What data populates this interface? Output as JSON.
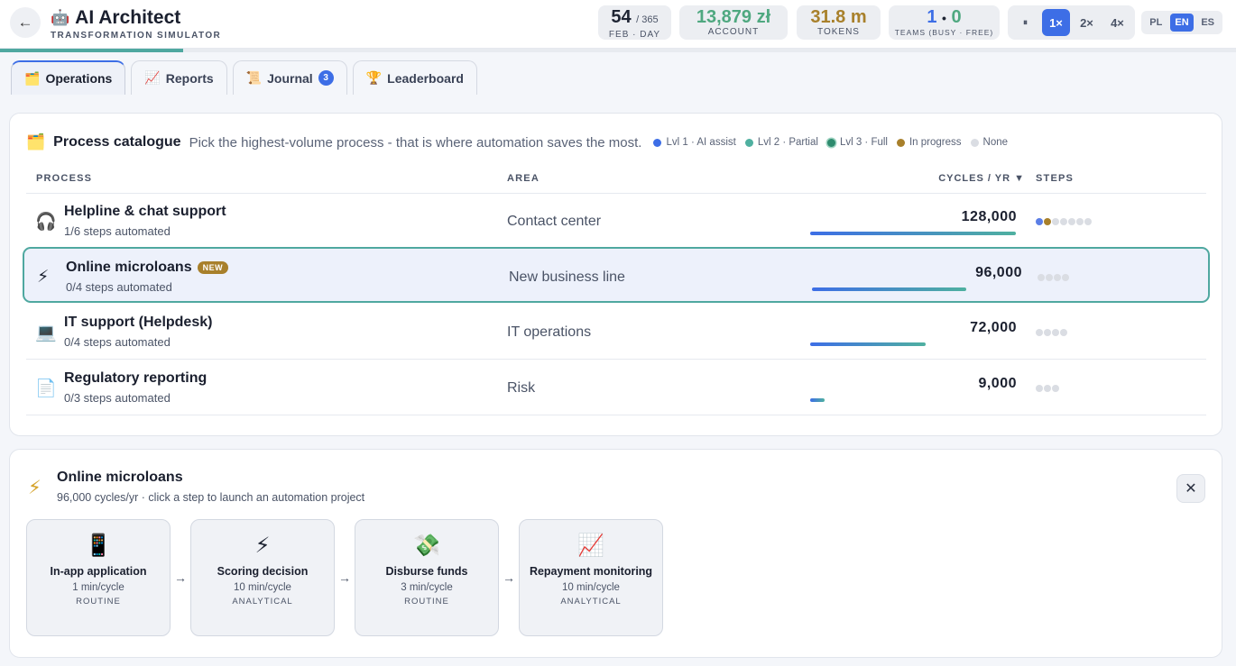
{
  "header": {
    "back_icon": "←",
    "robot_icon": "🤖",
    "title": "AI Architect",
    "subtitle": "TRANSFORMATION SIMULATOR",
    "day": "54",
    "day_total": "/ 365",
    "day_label": "FEB · DAY",
    "account": "13,879 zł",
    "account_label": "ACCOUNT",
    "tokens": "31.8 m",
    "tokens_label": "TOKENS",
    "teams_busy": "1",
    "teams_sep": "•",
    "teams_free": "0",
    "teams_label": "TEAMS (BUSY · FREE)",
    "pause_icon": "⏸",
    "speeds": [
      "1×",
      "2×",
      "4×"
    ],
    "active_speed": "1×",
    "languages": [
      "PL",
      "EN",
      "ES"
    ],
    "active_language": "EN",
    "colors": {
      "account": "#4fa880",
      "tokens": "#a8802b",
      "busy": "#3d6ee6",
      "free": "#4fa880",
      "accent": "#3d6ee6"
    }
  },
  "tabs": [
    {
      "icon": "🗂️",
      "label": "Operations",
      "active": true
    },
    {
      "icon": "📈",
      "label": "Reports"
    },
    {
      "icon": "📜",
      "label": "Journal",
      "badge": "3"
    },
    {
      "icon": "🏆",
      "label": "Leaderboard"
    }
  ],
  "catalogue": {
    "icon": "🗂️",
    "title": "Process catalogue",
    "subtitle": "Pick the highest-volume process - that is where automation saves the most.",
    "legend": [
      {
        "label": "Lvl 1 · AI assist",
        "color": "#3d6ee6"
      },
      {
        "label": "Lvl 2 · Partial",
        "color": "#4fb0a0"
      },
      {
        "label": "Lvl 3 · Full",
        "color": "#2e8b6e"
      },
      {
        "label": "In progress",
        "color": "#a8802b"
      },
      {
        "label": "None",
        "color": "#dadde3"
      }
    ],
    "columns": {
      "process": "PROCESS",
      "area": "AREA",
      "cycles": "CYCLES / YR ▼",
      "steps": "STEPS"
    },
    "rows": [
      {
        "icon": "🎧",
        "name": "Helpline & chat support",
        "sub": "1/6 steps automated",
        "area": "Contact center",
        "cycles": "128,000",
        "volume_fraction": 1.0,
        "steps": [
          "#5b7ee6",
          "#a8802b",
          "#dadde3",
          "#dadde3",
          "#dadde3",
          "#dadde3",
          "#dadde3"
        ]
      },
      {
        "icon": "⚡",
        "name": "Online microloans",
        "badge": "NEW",
        "sub": "0/4 steps automated",
        "area": "New business line",
        "cycles": "96,000",
        "volume_fraction": 0.75,
        "steps": [
          "#dadde3",
          "#dadde3",
          "#dadde3",
          "#dadde3"
        ],
        "selected": true
      },
      {
        "icon": "💻",
        "name": "IT support (Helpdesk)",
        "sub": "0/4 steps automated",
        "area": "IT operations",
        "cycles": "72,000",
        "volume_fraction": 0.5625,
        "steps": [
          "#dadde3",
          "#dadde3",
          "#dadde3",
          "#dadde3"
        ]
      },
      {
        "icon": "📄",
        "name": "Regulatory reporting",
        "sub": "0/3 steps automated",
        "area": "Risk",
        "cycles": "9,000",
        "volume_fraction": 0.07,
        "steps": [
          "#dadde3",
          "#dadde3",
          "#dadde3"
        ]
      }
    ]
  },
  "detail": {
    "icon": "⚡",
    "title": "Online microloans",
    "subtitle": "96,000 cycles/yr · click a step to launch an automation project",
    "close_icon": "✕",
    "arrow": "→",
    "steps": [
      {
        "icon": "📱",
        "name": "In-app application",
        "time": "1 min/cycle",
        "kind": "ROUTINE"
      },
      {
        "icon": "⚡",
        "name": "Scoring decision",
        "time": "10 min/cycle",
        "kind": "ANALYTICAL"
      },
      {
        "icon": "💸",
        "name": "Disburse funds",
        "time": "3 min/cycle",
        "kind": "ROUTINE"
      },
      {
        "icon": "📈",
        "name": "Repayment monitoring",
        "time": "10 min/cycle",
        "kind": "ANALYTICAL"
      }
    ]
  },
  "year_progress_fraction": 0.148
}
